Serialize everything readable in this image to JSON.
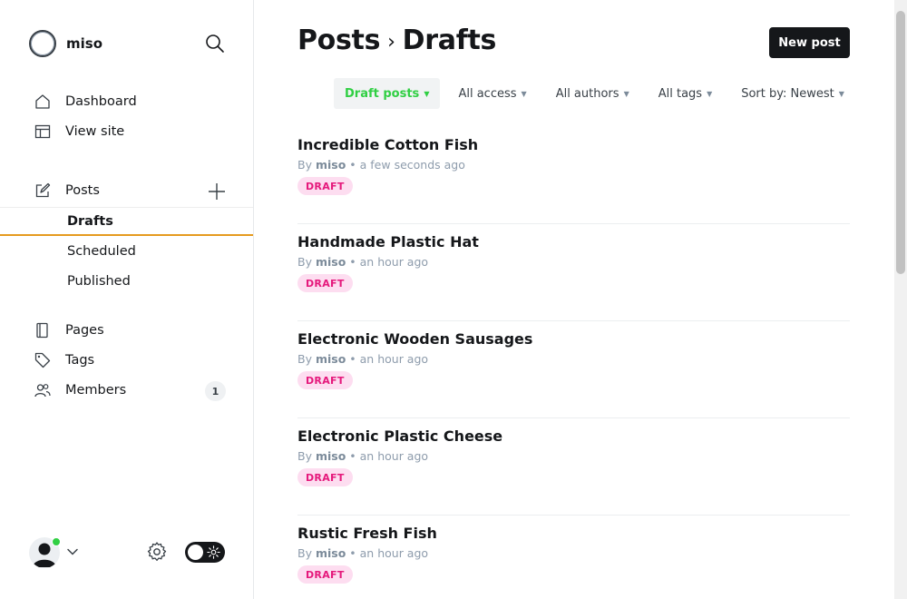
{
  "sidebar": {
    "brand": "miso",
    "nav": [
      {
        "label": "Dashboard",
        "icon": "home-icon"
      },
      {
        "label": "View site",
        "icon": "layout-icon"
      }
    ],
    "posts": {
      "label": "Posts",
      "icon": "edit-icon"
    },
    "post_subitems": [
      {
        "label": "Drafts",
        "active": true
      },
      {
        "label": "Scheduled"
      },
      {
        "label": "Published"
      }
    ],
    "nav2": [
      {
        "label": "Pages",
        "icon": "page-icon"
      },
      {
        "label": "Tags",
        "icon": "tag-icon"
      },
      {
        "label": "Members",
        "icon": "members-icon"
      }
    ],
    "members_count": "1"
  },
  "header": {
    "title_parent": "Posts",
    "title_separator": "›",
    "title_current": "Drafts",
    "new_post_label": "New post"
  },
  "filters": [
    {
      "label": "Draft posts",
      "active": true
    },
    {
      "label": "All access"
    },
    {
      "label": "All authors"
    },
    {
      "label": "All tags"
    },
    {
      "label": "Sort by: Newest"
    }
  ],
  "posts": [
    {
      "title": "Incredible Cotton Fish",
      "by": "By",
      "author": "miso",
      "time": "• a few seconds ago",
      "status": "DRAFT"
    },
    {
      "title": "Handmade Plastic Hat",
      "by": "By",
      "author": "miso",
      "time": "• an hour ago",
      "status": "DRAFT"
    },
    {
      "title": "Electronic Wooden Sausages",
      "by": "By",
      "author": "miso",
      "time": "• an hour ago",
      "status": "DRAFT"
    },
    {
      "title": "Electronic Plastic Cheese",
      "by": "By",
      "author": "miso",
      "time": "• an hour ago",
      "status": "DRAFT"
    },
    {
      "title": "Rustic Fresh Fish",
      "by": "By",
      "author": "miso",
      "time": "• an hour ago",
      "status": "DRAFT"
    }
  ],
  "colors": {
    "accent_green": "#30cf43",
    "draft_pink": "#e5197c",
    "active_underline": "#e59a1f"
  }
}
